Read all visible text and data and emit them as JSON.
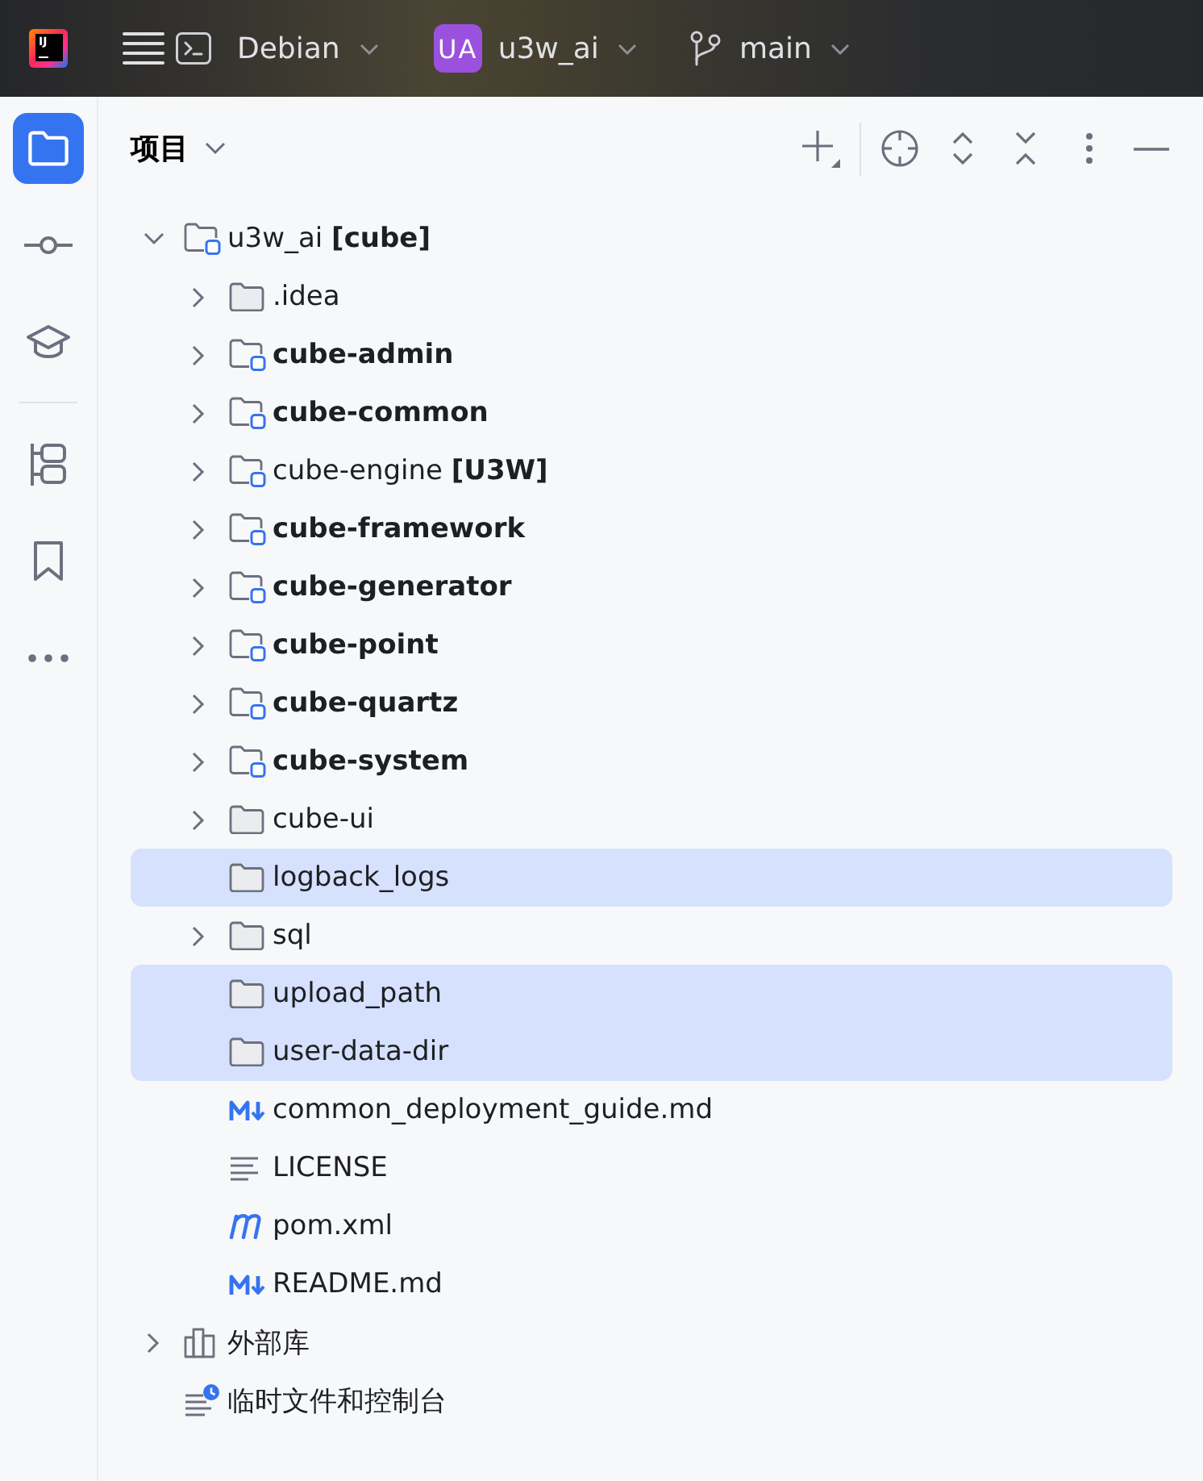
{
  "title_bar": {
    "logo": {
      "text": "IJ"
    },
    "run_target": {
      "label": "Debian"
    },
    "project": {
      "badge": "UA",
      "name": "u3w_ai"
    },
    "branch": {
      "name": "main"
    }
  },
  "tool_strip": {
    "groups": [
      {
        "items": [
          {
            "kind": "project",
            "selected": true
          },
          {
            "kind": "commit",
            "selected": false
          },
          {
            "kind": "learn",
            "selected": false
          }
        ]
      },
      {
        "items": [
          {
            "kind": "structure",
            "selected": false
          },
          {
            "kind": "bookmarks",
            "selected": false
          },
          {
            "kind": "more",
            "selected": false
          }
        ]
      }
    ]
  },
  "project_panel": {
    "title": "项目",
    "tree": [
      {
        "label": "u3w_ai **[cube]**",
        "kind": "module",
        "expanded": true,
        "selected": false,
        "children": [
          {
            "label": ".idea",
            "kind": "folder",
            "expanded": false,
            "selected": false
          },
          {
            "label": "cube-admin",
            "kind": "module",
            "bold": true,
            "expanded": false,
            "selected": false
          },
          {
            "label": "cube-common",
            "kind": "module",
            "bold": true,
            "expanded": false,
            "selected": false
          },
          {
            "label": "cube-engine **[U3W]**",
            "kind": "module",
            "expanded": false,
            "selected": false
          },
          {
            "label": "cube-framework",
            "kind": "module",
            "bold": true,
            "expanded": false,
            "selected": false
          },
          {
            "label": "cube-generator",
            "kind": "module",
            "bold": true,
            "expanded": false,
            "selected": false
          },
          {
            "label": "cube-point",
            "kind": "module",
            "bold": true,
            "expanded": false,
            "selected": false
          },
          {
            "label": "cube-quartz",
            "kind": "module",
            "bold": true,
            "expanded": false,
            "selected": false
          },
          {
            "label": "cube-system",
            "kind": "module",
            "bold": true,
            "expanded": false,
            "selected": false
          },
          {
            "label": "cube-ui",
            "kind": "folder",
            "expanded": false,
            "selected": false
          },
          {
            "label": "logback_logs",
            "kind": "folder",
            "selected": true
          },
          {
            "label": "sql",
            "kind": "folder",
            "expanded": false,
            "selected": false
          },
          {
            "label": "upload_path",
            "kind": "folder",
            "selected": true
          },
          {
            "label": "user-data-dir",
            "kind": "folder",
            "selected": true
          },
          {
            "label": "common_deployment_guide.md",
            "kind": "markdown",
            "selected": false
          },
          {
            "label": "LICENSE",
            "kind": "text",
            "selected": false
          },
          {
            "label": "pom.xml",
            "kind": "maven",
            "selected": false
          },
          {
            "label": "README.md",
            "kind": "markdown",
            "selected": false
          }
        ]
      },
      {
        "label": "外部库",
        "kind": "library",
        "expanded": false,
        "selected": false
      },
      {
        "label": "临时文件和控制台",
        "kind": "scratches",
        "selected": false
      }
    ]
  }
}
